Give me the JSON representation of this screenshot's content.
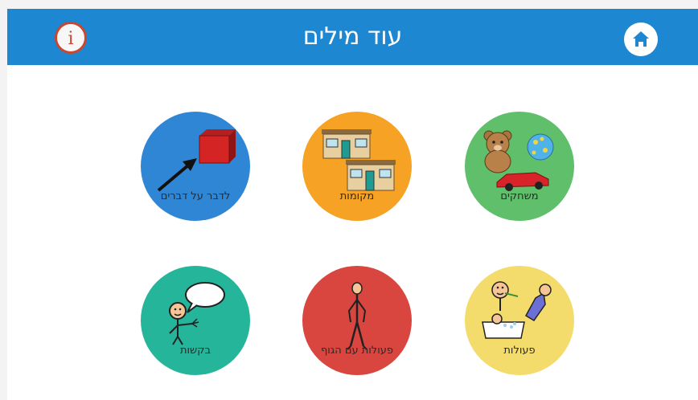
{
  "header": {
    "title": "עוד מילים",
    "info_label": "i",
    "home_icon": "home-icon",
    "background": "#1e87d2"
  },
  "tiles": [
    {
      "label": "לדבר על דברים",
      "color": "#2f86d5"
    },
    {
      "label": "מקומות",
      "color": "#f6a224"
    },
    {
      "label": "משחקים",
      "color": "#5fbf6a"
    },
    {
      "label": "בקשות",
      "color": "#25b59a"
    },
    {
      "label": "פעולות עם הגוף",
      "color": "#d9453f"
    },
    {
      "label": "פעולות",
      "color": "#f3dc6b"
    }
  ]
}
